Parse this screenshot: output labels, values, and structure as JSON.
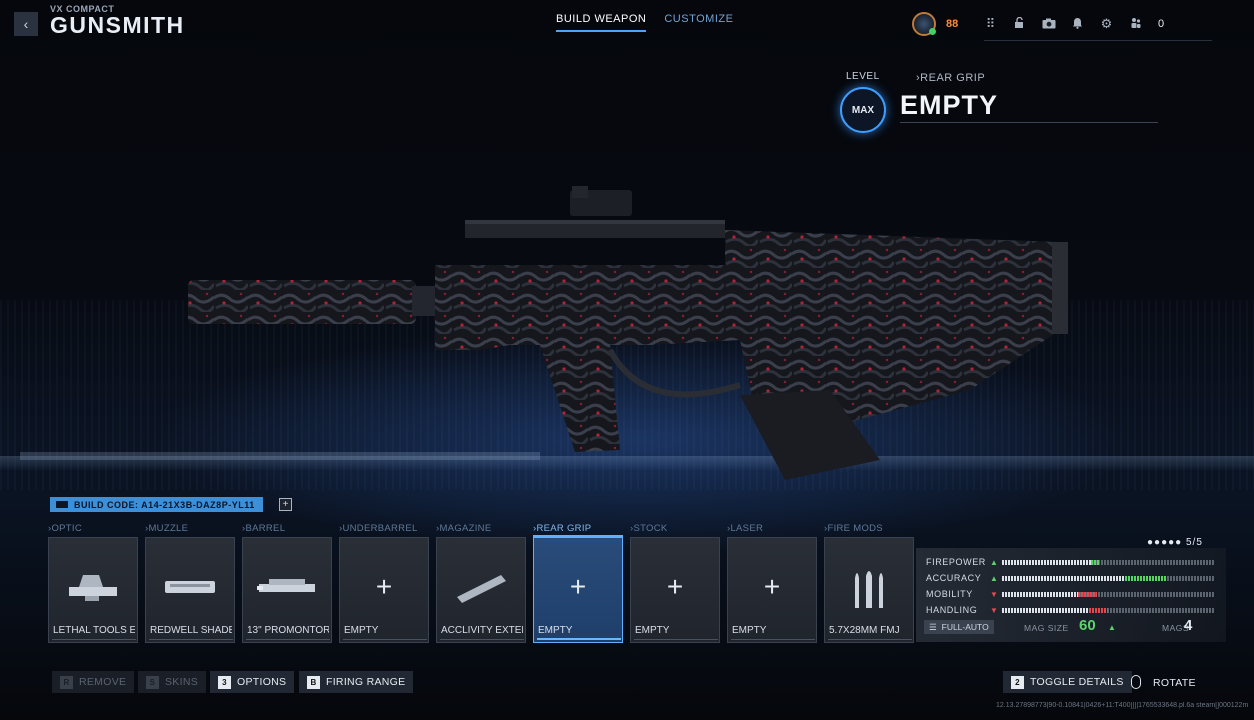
{
  "header": {
    "weapon_name": "VX COMPACT",
    "title": "GUNSMITH",
    "back_icon": "back-chevron-icon",
    "tabs": [
      {
        "label": "BUILD WEAPON",
        "active": true
      },
      {
        "label": "CUSTOMIZE",
        "active": false
      }
    ],
    "player_level": "88",
    "party_count": "0",
    "icons": [
      "grid-menu-icon",
      "unlock-icon",
      "camera-icon",
      "bell-icon",
      "gear-icon",
      "party-icon"
    ]
  },
  "attachment_info": {
    "level_label": "LEVEL",
    "level_badge": "MAX",
    "slot_header": "›REAR GRIP",
    "slot_value": "EMPTY"
  },
  "build_code": {
    "text": "BUILD CODE: A14-21X3B-DAZ8P-YL11",
    "copy_icon": "copy-icon"
  },
  "slots": [
    {
      "category": "›OPTIC",
      "name": "LETHAL TOOLS E",
      "icon": "optic-icon",
      "empty": false,
      "selected": false
    },
    {
      "category": "›MUZZLE",
      "name": "REDWELL SHADE",
      "icon": "muzzle-icon",
      "empty": false,
      "selected": false
    },
    {
      "category": "›BARREL",
      "name": "13\" PROMONTORY",
      "icon": "barrel-icon",
      "empty": false,
      "selected": false
    },
    {
      "category": "›UNDERBARREL",
      "name": "EMPTY",
      "icon": "plus-icon",
      "empty": true,
      "selected": false
    },
    {
      "category": "›MAGAZINE",
      "name": "ACCLIVITY EXTEN",
      "icon": "magazine-icon",
      "empty": false,
      "selected": false
    },
    {
      "category": "›REAR GRIP",
      "name": "EMPTY",
      "icon": "plus-icon",
      "empty": true,
      "selected": true
    },
    {
      "category": "›STOCK",
      "name": "EMPTY",
      "icon": "plus-icon",
      "empty": true,
      "selected": false
    },
    {
      "category": "›LASER",
      "name": "EMPTY",
      "icon": "plus-icon",
      "empty": true,
      "selected": false
    },
    {
      "category": "›FIRE MODS",
      "name": "5.7X28MM FMJ",
      "icon": "ammo-icon",
      "empty": false,
      "selected": false
    }
  ],
  "attachment_count": "5/5",
  "stats": [
    {
      "label": "FIREPOWER",
      "direction": "up",
      "base": 0.42,
      "delta": 0.04
    },
    {
      "label": "ACCURACY",
      "direction": "up",
      "base": 0.58,
      "delta": 0.2
    },
    {
      "label": "MOBILITY",
      "direction": "down",
      "base": 0.45,
      "delta": 0.09
    },
    {
      "label": "HANDLING",
      "direction": "down",
      "base": 0.5,
      "delta": 0.09
    }
  ],
  "weapon_stats": {
    "fire_mode": "FULL-AUTO",
    "mag_size_label": "MAG SIZE",
    "mag_size_value": "60",
    "mags_label": "MAGS",
    "mags_value": "4"
  },
  "colors": {
    "accent": "#3d9eff",
    "stat_up": "#5bd36b",
    "stat_down": "#e2494e",
    "level_orange": "#ff8a3a"
  },
  "bottom_bar": {
    "buttons": [
      {
        "key": "R",
        "label": "REMOVE",
        "enabled": false
      },
      {
        "key": "S",
        "label": "SKINS",
        "enabled": false
      },
      {
        "key": "3",
        "label": "OPTIONS",
        "enabled": true
      },
      {
        "key": "B",
        "label": "FIRING RANGE",
        "enabled": true
      }
    ],
    "toggle_details": {
      "key": "2",
      "label": "TOGGLE DETAILS"
    },
    "rotate_label": "ROTATE",
    "version": "12.13.27898773|90-0.10841|0426+11:T400]]]|1765533648.pl.6a steam[]000122m"
  }
}
